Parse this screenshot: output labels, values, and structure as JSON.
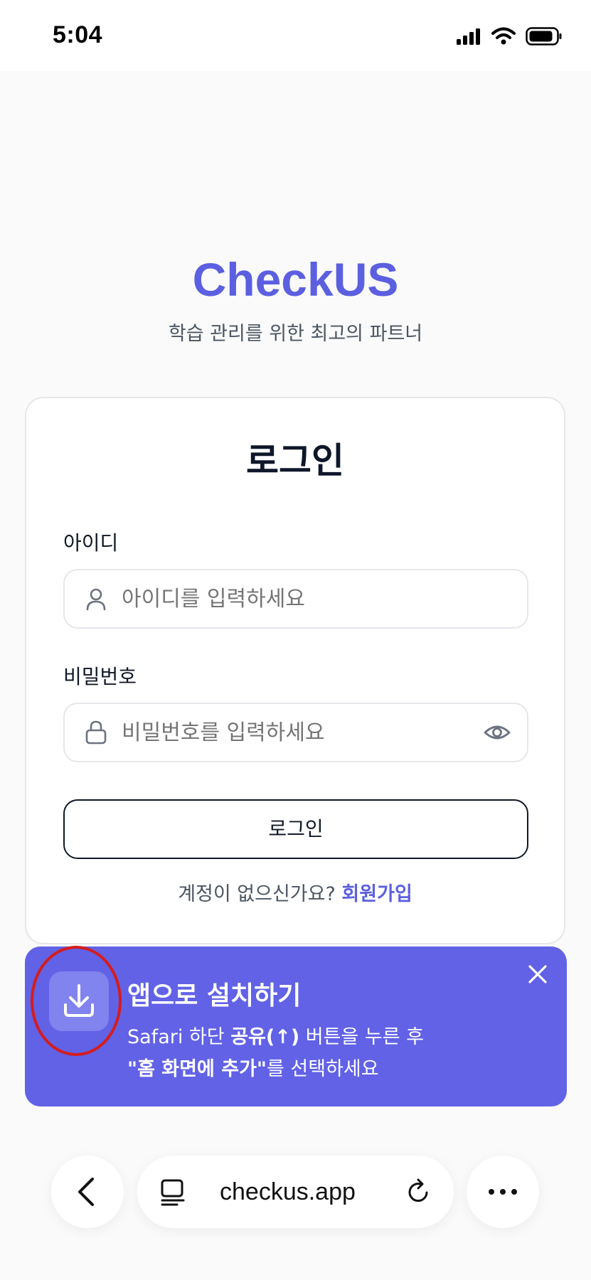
{
  "status_bar": {
    "time": "5:04"
  },
  "brand": {
    "title": "CheckUS",
    "subtitle": "학습 관리를 위한 최고의 파트너",
    "accent_color": "#5b5fe0"
  },
  "login_card": {
    "title": "로그인",
    "id_label": "아이디",
    "id_placeholder": "아이디를 입력하세요",
    "password_label": "비밀번호",
    "password_placeholder": "비밀번호를 입력하세요",
    "submit_label": "로그인",
    "no_account_text": "계정이 없으신가요?",
    "signup_link": "회원가입"
  },
  "install_banner": {
    "title": "앱으로 설치하기",
    "line1_prefix": "Safari 하단 ",
    "line1_bold": "공유(↑)",
    "line1_suffix": " 버튼을 누른 후",
    "line2_bold": "\"홈 화면에 추가\"",
    "line2_suffix": "를 선택하세요",
    "background_color": "#6162e6",
    "icon": "download-icon"
  },
  "browser_bar": {
    "url": "checkus.app"
  }
}
